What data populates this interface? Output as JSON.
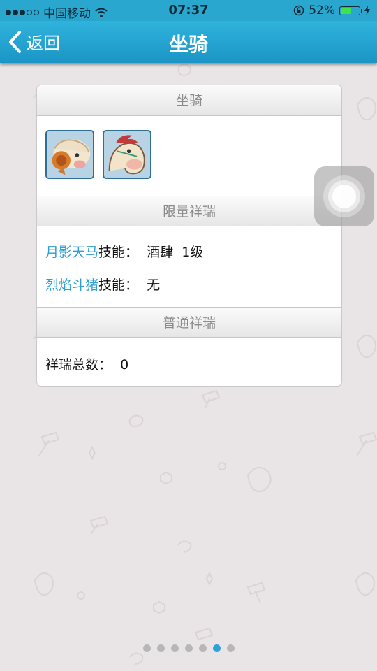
{
  "status_bar": {
    "carrier": "中国移动",
    "time": "07:37",
    "battery": "52%",
    "battery_level": 0.52,
    "signal_bars_filled": 3,
    "signal_bars_total": 5
  },
  "nav": {
    "back_label": "返回",
    "title": "坐骑"
  },
  "card": {
    "mounts_header": "坐骑",
    "limited_header": "限量祥瑞",
    "limited_items": [
      {
        "name": "月影天马",
        "skill_label": "技能：",
        "skill_value": "酒肆  1级"
      },
      {
        "name": "烈焰斗猪",
        "skill_label": "技能：",
        "skill_value": "无"
      }
    ],
    "normal_header": "普通祥瑞",
    "normal_total_label": "祥瑞总数：",
    "normal_total_value": "0"
  },
  "page_indicator": {
    "total": 7,
    "active_index": 5
  },
  "colors": {
    "accent": "#2aa7cf",
    "link": "#2e9fd1",
    "background": "#e9e4e6"
  }
}
